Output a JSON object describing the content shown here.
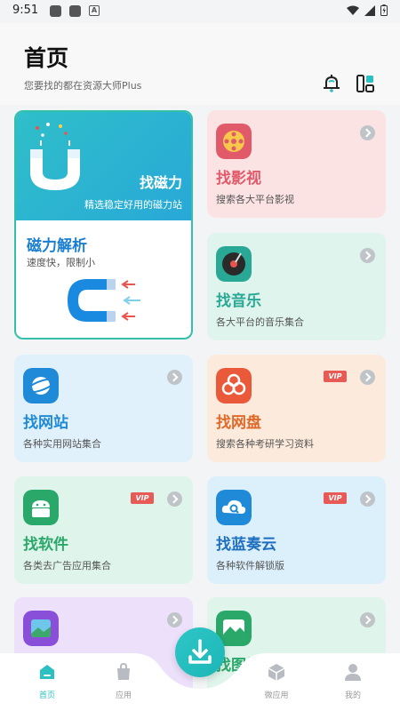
{
  "status": {
    "time": "9:51"
  },
  "header": {
    "title": "首页",
    "subtitle": "您要找的都在资源大师Plus"
  },
  "colors": {
    "accent": "#2cc0c0",
    "vip": "#e85a55"
  },
  "magnet_card": {
    "title": "找磁力",
    "subtitle": "精选稳定好用的磁力站",
    "parse_title": "磁力解析",
    "parse_sub": "速度快，限制小"
  },
  "cards": [
    {
      "title": "找影视",
      "subtitle": "搜索各大平台影视",
      "icon": "film-reel-icon",
      "color": "#e05a6a"
    },
    {
      "title": "找音乐",
      "subtitle": "各大平台的音乐集合",
      "icon": "vinyl-record-icon",
      "color": "#2aa896"
    },
    {
      "title": "找网站",
      "subtitle": "各种实用网站集合",
      "icon": "planet-icon",
      "color": "#1f8ad8"
    },
    {
      "title": "找网盘",
      "subtitle": "搜索各种考研学习资料",
      "icon": "cloud-disk-icon",
      "color": "#e06a2a",
      "vip": "VIP"
    },
    {
      "title": "找软件",
      "subtitle": "各类去广告应用集合",
      "icon": "android-icon",
      "color": "#2aa86a",
      "vip": "VIP"
    },
    {
      "title": "找蓝奏云",
      "subtitle": "各种软件解锁版",
      "icon": "cloud-search-icon",
      "color": "#1f8ad8",
      "vip": "VIP"
    },
    {
      "title": "",
      "subtitle": "",
      "icon": "image-icon",
      "color": "#8a4fd8"
    },
    {
      "title": "找图片",
      "subtitle": "",
      "icon": "landscape-icon",
      "color": "#2aa86a"
    }
  ],
  "nav": [
    {
      "label": "首页",
      "icon": "home-icon"
    },
    {
      "label": "应用",
      "icon": "bag-icon"
    },
    {
      "label": "微应用",
      "icon": "cube-icon"
    },
    {
      "label": "我的",
      "icon": "user-icon"
    }
  ],
  "fab": {
    "icon": "download-icon"
  }
}
